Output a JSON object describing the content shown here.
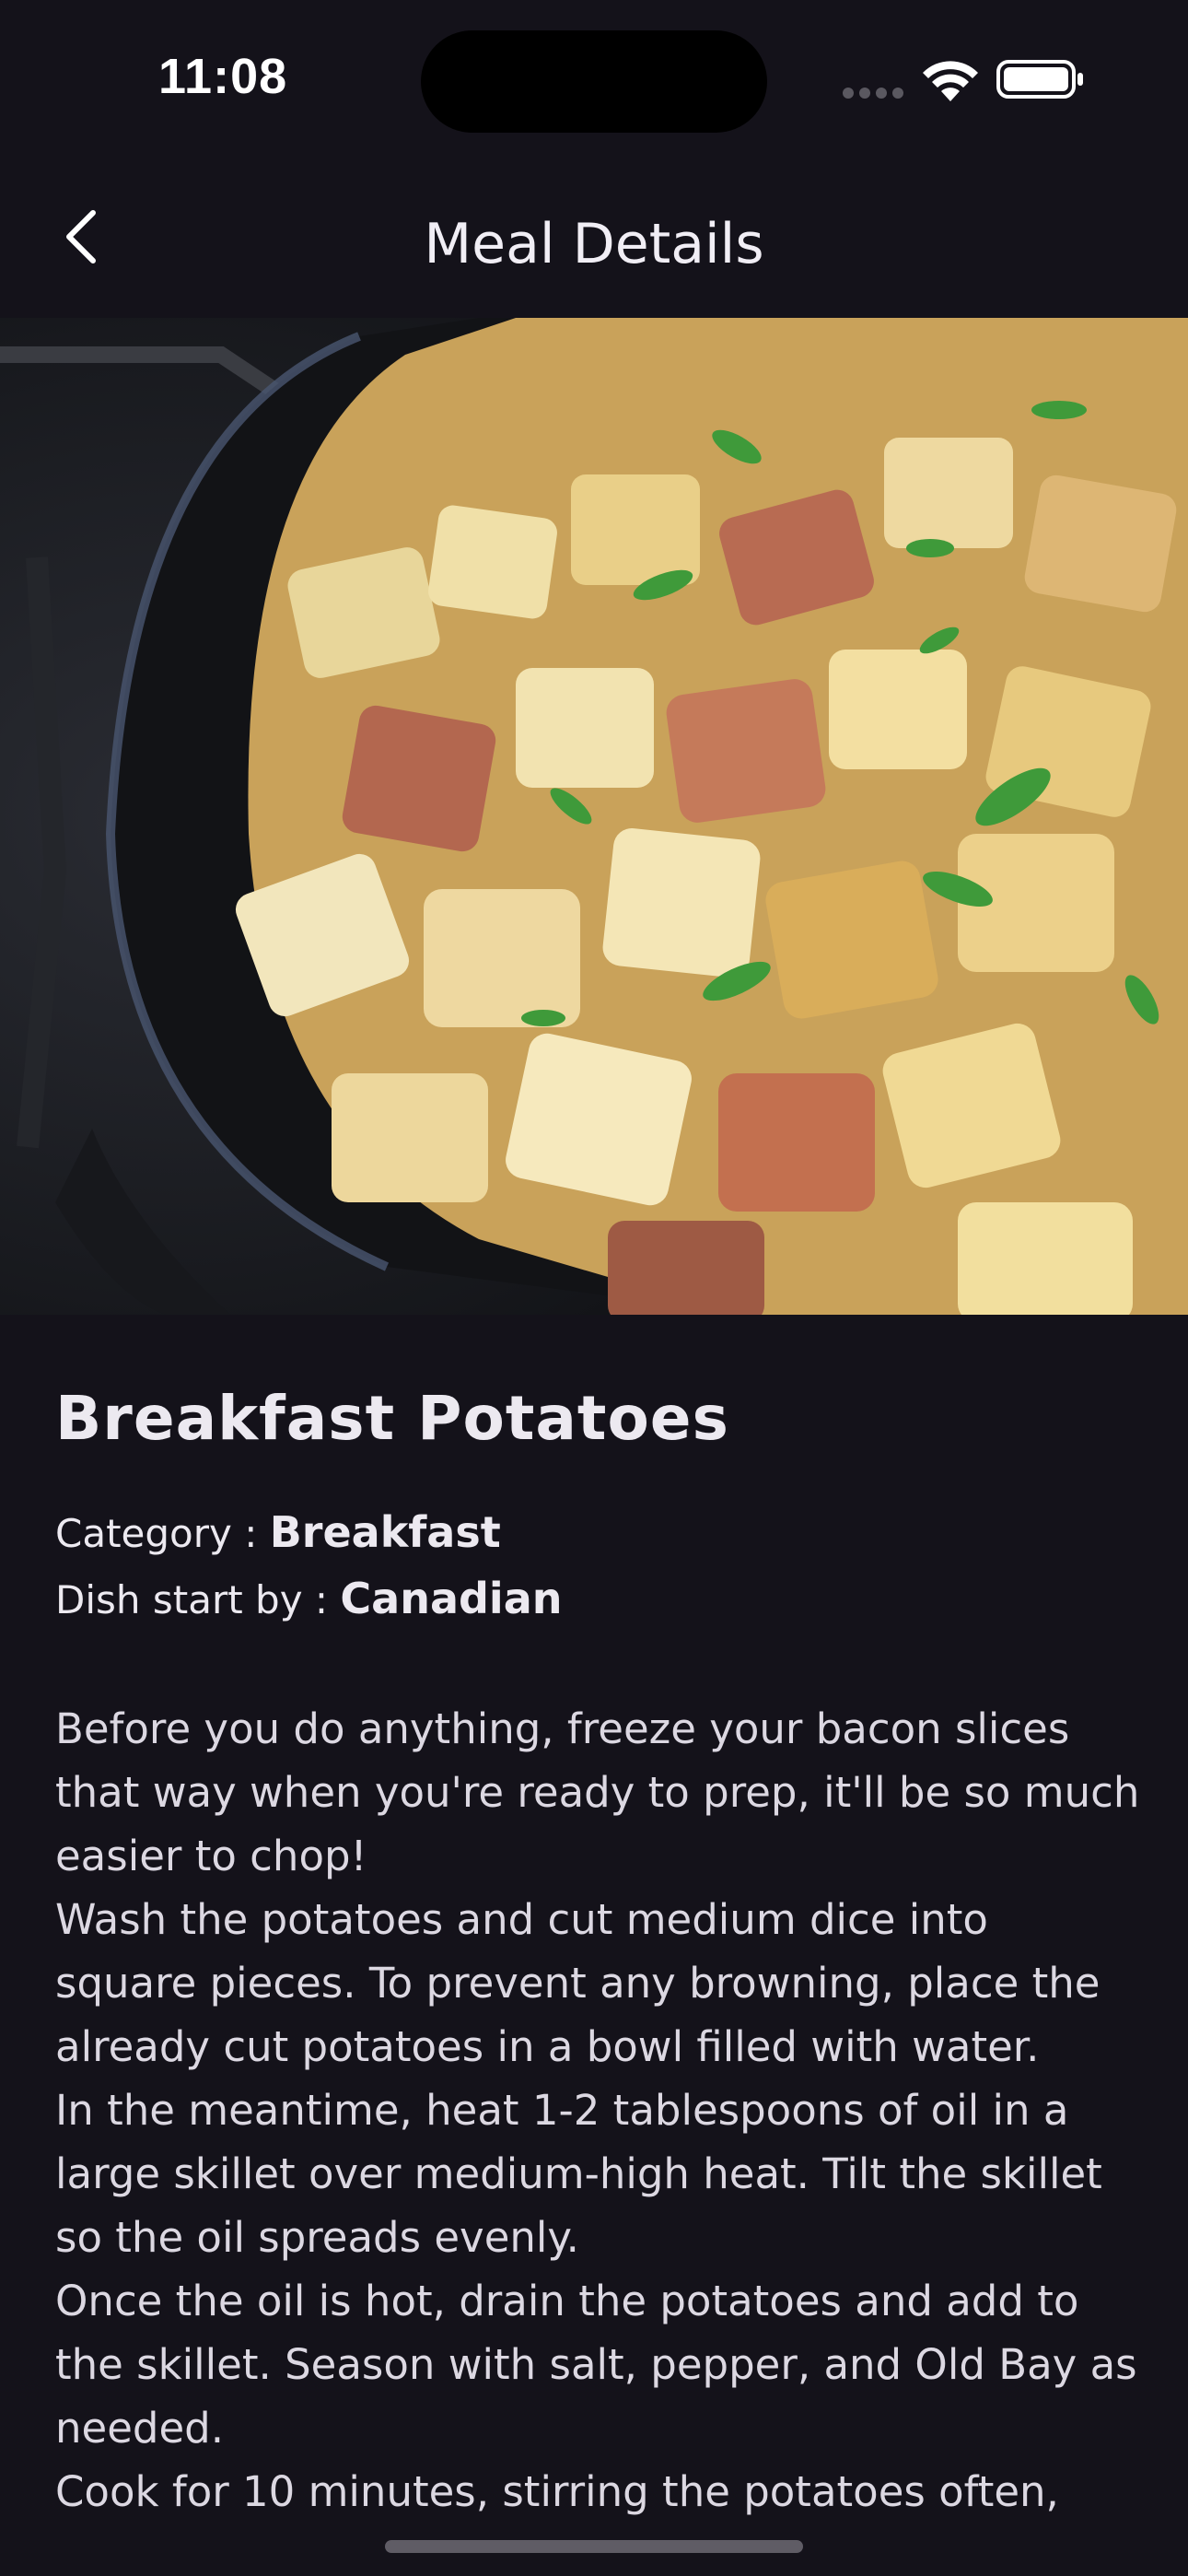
{
  "status_bar": {
    "time": "11:08"
  },
  "nav": {
    "title": "Meal Details"
  },
  "meal": {
    "title": "Breakfast Potatoes",
    "category_label": "Category : ",
    "category": "Breakfast",
    "origin_label": "Dish start by : ",
    "origin": "Canadian",
    "instructions": "Before you do anything, freeze your bacon slices that way when you're ready to prep, it'll be so much easier to chop!\nWash the potatoes and cut medium dice into square pieces. To prevent any browning, place the already cut potatoes in a bowl filled with water.\nIn the meantime, heat 1-2 tablespoons of oil in a large skillet over medium-high heat. Tilt the skillet so the oil spreads evenly.\nOnce the oil is hot, drain the potatoes and add to the skillet. Season with salt, pepper, and Old Bay as needed.\nCook for 10 minutes, stirring the potatoes often,"
  }
}
